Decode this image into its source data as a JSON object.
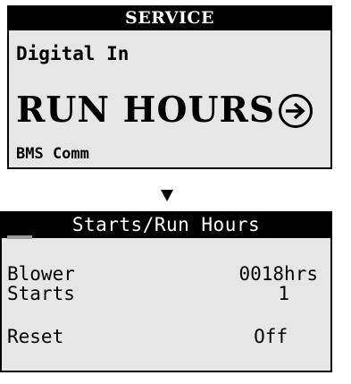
{
  "screen1": {
    "title": "SERVICE",
    "item_prev": "Digital In",
    "item_selected": "RUN HOURS",
    "item_next": "BMS Comm"
  },
  "screen2": {
    "title": "Starts/Run Hours",
    "rows": [
      {
        "label": "Blower",
        "value": "0018hrs"
      },
      {
        "label": "Starts",
        "value": "1"
      },
      {
        "label": "Reset",
        "value": "Off"
      }
    ]
  },
  "icons": {
    "enter": "arrow-right-circle-icon",
    "flow": "triangle-down-icon"
  }
}
